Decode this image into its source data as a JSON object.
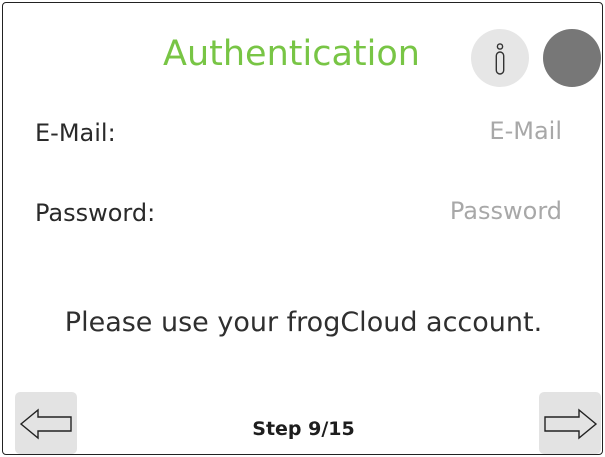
{
  "header": {
    "title": "Authentication",
    "title_color": "#78c545",
    "info_icon": "info-icon",
    "status_indicator_color": "#777777"
  },
  "form": {
    "email": {
      "label": "E-Mail:",
      "placeholder": "E-Mail",
      "value": ""
    },
    "password": {
      "label": "Password:",
      "placeholder": "Password",
      "value": ""
    }
  },
  "hint_text": "Please use your frogCloud account.",
  "footer": {
    "step_text": "Step 9/15",
    "prev_icon": "arrow-left-icon",
    "next_icon": "arrow-right-icon"
  }
}
